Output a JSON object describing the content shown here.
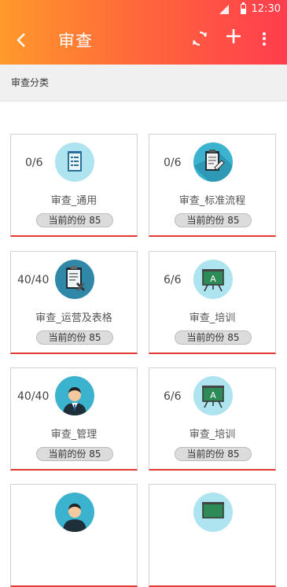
{
  "status_bar": {
    "time": "12:30"
  },
  "app_bar": {
    "title": "审查",
    "back_icon": "chevron-left-icon",
    "refresh_icon": "refresh-icon",
    "add_icon": "plus-icon",
    "more_icon": "more-vertical-icon"
  },
  "colors": {
    "gradient_start": "#ff9a2a",
    "gradient_end": "#ff3d4e",
    "accent_line": "#e53935"
  },
  "category": {
    "label": "审查分类"
  },
  "cards": [
    {
      "count": "0/6",
      "name": "审查_通用",
      "badge": "当前的份 85",
      "icon": "checklist-icon"
    },
    {
      "count": "0/6",
      "name": "审查_标准流程",
      "badge": "当前的份 85",
      "icon": "clipboard-pen-icon"
    },
    {
      "count": "40/40",
      "name": "审查_运营及表格",
      "badge": "当前的份 85",
      "icon": "clipboard-tools-icon"
    },
    {
      "count": "6/6",
      "name": "审查_培训",
      "badge": "当前的份 85",
      "icon": "presentation-board-icon"
    },
    {
      "count": "40/40",
      "name": "审查_管理",
      "badge": "当前的份 85",
      "icon": "manager-avatar-icon"
    },
    {
      "count": "6/6",
      "name": "审查_培训",
      "badge": "当前的份 85",
      "icon": "presentation-board-icon"
    },
    {
      "count": "",
      "name": "",
      "badge": "",
      "icon": "manager-avatar-icon"
    },
    {
      "count": "",
      "name": "",
      "badge": "",
      "icon": "presentation-board-icon"
    }
  ]
}
